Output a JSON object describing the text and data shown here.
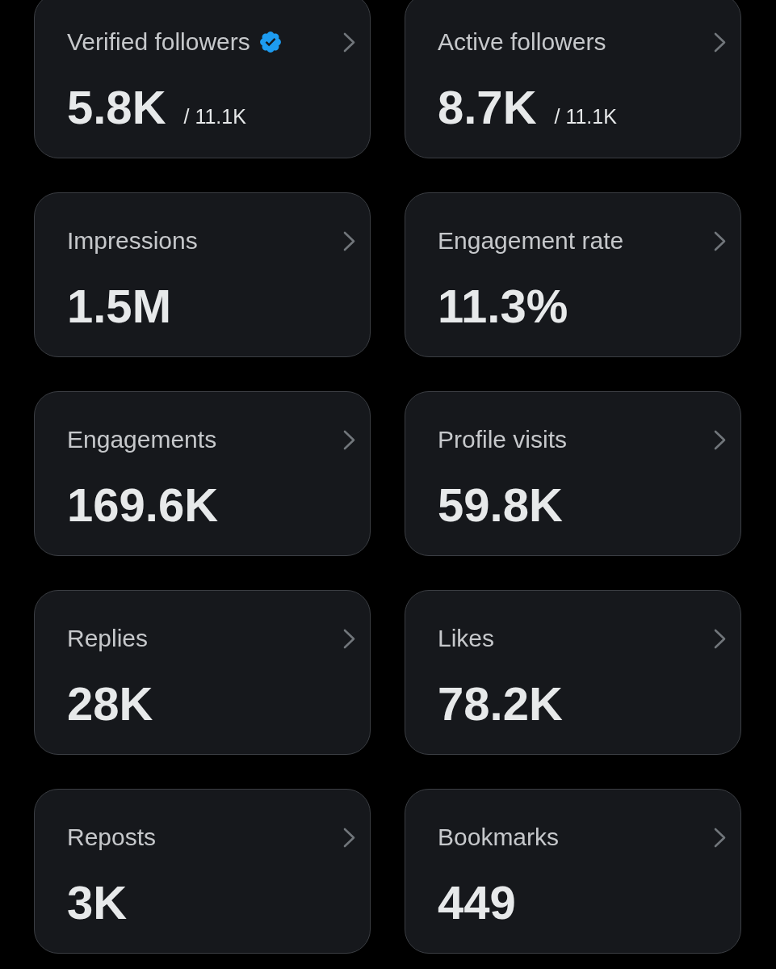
{
  "cards": [
    {
      "label": "Verified followers",
      "verified": true,
      "value": "5.8K",
      "total": "/ 11.1K"
    },
    {
      "label": "Active followers",
      "verified": false,
      "value": "8.7K",
      "total": "/ 11.1K"
    },
    {
      "label": "Impressions",
      "verified": false,
      "value": "1.5M"
    },
    {
      "label": "Engagement rate",
      "verified": false,
      "value": "11.3%"
    },
    {
      "label": "Engagements",
      "verified": false,
      "value": "169.6K"
    },
    {
      "label": "Profile visits",
      "verified": false,
      "value": "59.8K"
    },
    {
      "label": "Replies",
      "verified": false,
      "value": "28K"
    },
    {
      "label": "Likes",
      "verified": false,
      "value": "78.2K"
    },
    {
      "label": "Reposts",
      "verified": false,
      "value": "3K"
    },
    {
      "label": "Bookmarks",
      "verified": false,
      "value": "449"
    }
  ]
}
